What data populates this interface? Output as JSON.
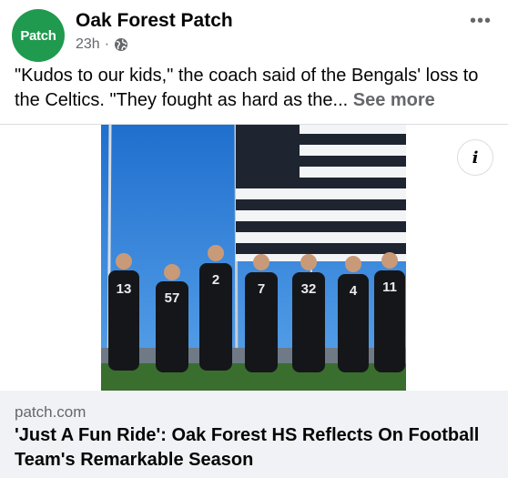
{
  "post": {
    "page_name": "Oak Forest Patch",
    "avatar_text": "Patch",
    "time": "23h",
    "separator": "·",
    "more_label": "•••",
    "text": "\"Kudos to our kids,\" the coach said of the Bengals' loss to the Celtics. \"They fought as hard as the...",
    "see_more": "See more"
  },
  "link": {
    "info_label": "i",
    "domain": "patch.com",
    "headline": "'Just A Fun Ride': Oak Forest HS Reflects On Football Team's Remarkable Season"
  },
  "photo": {
    "jerseys": [
      "13",
      "57",
      "2",
      "7",
      "32",
      "4",
      "11"
    ],
    "colors": {
      "sky": "#2d7fd8",
      "uniform": "#15161a",
      "grass": "#3a6e2e",
      "accent_green": "#1f9a4f"
    }
  }
}
